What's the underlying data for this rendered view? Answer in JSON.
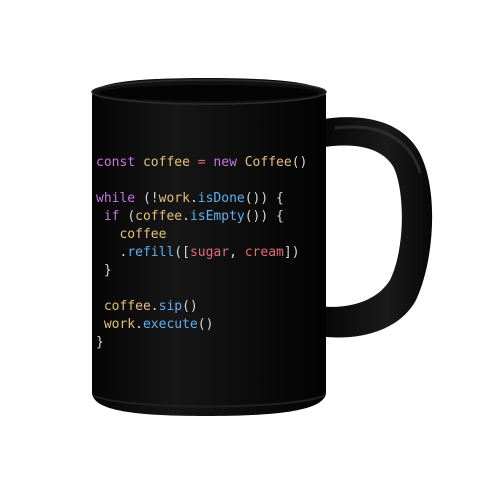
{
  "colors": {
    "background": "#ffffff",
    "mug": "#0a0a0a",
    "keyword": "#c678dd",
    "identifier": "#e5c07b",
    "function": "#61afef",
    "operator": "#e06c75",
    "punctuation": "#d7d7d7",
    "string": "#e06c75"
  },
  "code": [
    [
      {
        "t": "const ",
        "c": "keyword"
      },
      {
        "t": "coffee ",
        "c": "identifier"
      },
      {
        "t": "= ",
        "c": "operator"
      },
      {
        "t": "new ",
        "c": "keyword"
      },
      {
        "t": "Coffee",
        "c": "identifier"
      },
      {
        "t": "()",
        "c": "punctuation"
      }
    ],
    [],
    [
      {
        "t": "while ",
        "c": "keyword"
      },
      {
        "t": "(!",
        "c": "punctuation"
      },
      {
        "t": "work",
        "c": "identifier"
      },
      {
        "t": ".",
        "c": "punctuation"
      },
      {
        "t": "isDone",
        "c": "function"
      },
      {
        "t": "()) {",
        "c": "punctuation"
      }
    ],
    [
      {
        "t": " if ",
        "c": "keyword"
      },
      {
        "t": "(",
        "c": "punctuation"
      },
      {
        "t": "coffee",
        "c": "identifier"
      },
      {
        "t": ".",
        "c": "punctuation"
      },
      {
        "t": "isEmpty",
        "c": "function"
      },
      {
        "t": "()) {",
        "c": "punctuation"
      }
    ],
    [
      {
        "t": "   coffee",
        "c": "identifier"
      }
    ],
    [
      {
        "t": "   .",
        "c": "punctuation"
      },
      {
        "t": "refill",
        "c": "function"
      },
      {
        "t": "([",
        "c": "punctuation"
      },
      {
        "t": "sugar",
        "c": "string"
      },
      {
        "t": ", ",
        "c": "punctuation"
      },
      {
        "t": "cream",
        "c": "string"
      },
      {
        "t": "])",
        "c": "punctuation"
      }
    ],
    [
      {
        "t": " }",
        "c": "punctuation"
      }
    ],
    [],
    [
      {
        "t": " coffee",
        "c": "identifier"
      },
      {
        "t": ".",
        "c": "punctuation"
      },
      {
        "t": "sip",
        "c": "function"
      },
      {
        "t": "()",
        "c": "punctuation"
      }
    ],
    [
      {
        "t": " work",
        "c": "identifier"
      },
      {
        "t": ".",
        "c": "punctuation"
      },
      {
        "t": "execute",
        "c": "function"
      },
      {
        "t": "()",
        "c": "punctuation"
      }
    ],
    [
      {
        "t": "}",
        "c": "punctuation"
      }
    ]
  ]
}
